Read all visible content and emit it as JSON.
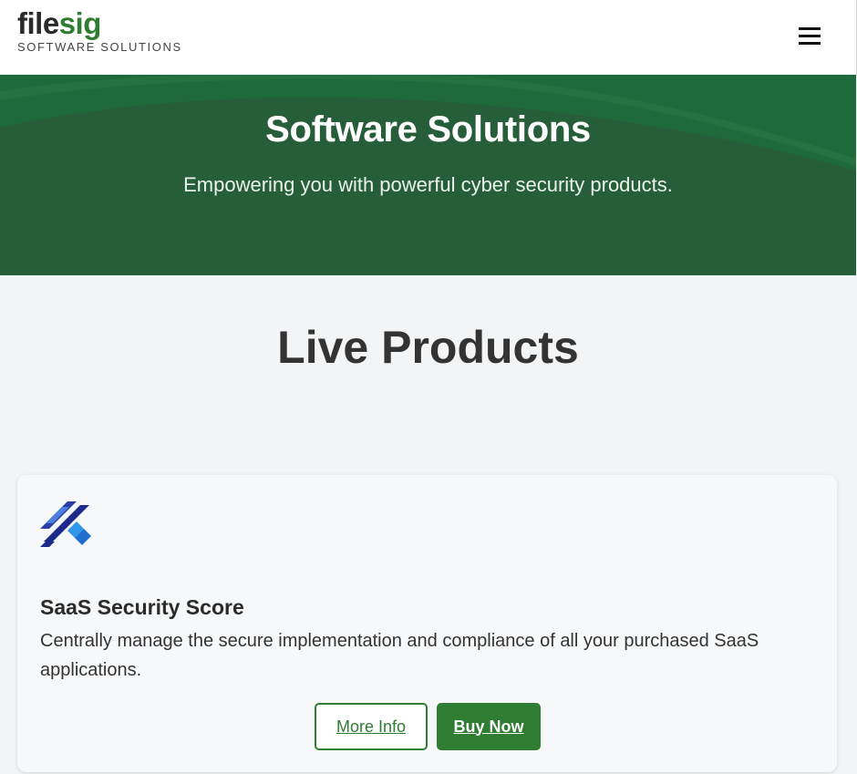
{
  "header": {
    "logo_part1": "file",
    "logo_part2": "sig",
    "logo_tagline": "SOFTWARE SOLUTIONS",
    "menu_icon": "hamburger-icon"
  },
  "hero": {
    "title": "Software Solutions",
    "subtitle": "Empowering you with powerful cyber security products."
  },
  "products_section": {
    "title": "Live Products",
    "items": [
      {
        "icon": "saas-security-score-logo-icon",
        "name": "SaaS Security Score",
        "description": "Centrally manage the secure implementation and compliance of all your purchased SaaS applications.",
        "more_info_label": "More Info",
        "buy_now_label": "Buy Now"
      }
    ]
  },
  "colors": {
    "brand_green": "#2e7d32",
    "hero_background": "#275e3a",
    "page_background": "#f3f4f5"
  }
}
